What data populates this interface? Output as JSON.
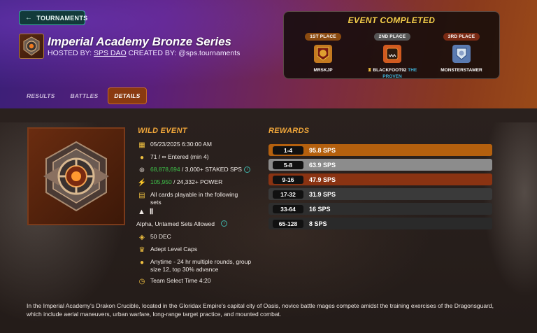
{
  "nav": {
    "back_label": "TOURNAMENTS"
  },
  "tournament": {
    "title": "Imperial Academy Bronze Series",
    "hosted_by_label": "HOSTED BY:",
    "host": "SPS DAO",
    "created_by_label": "CREATED BY:",
    "creator": "@sps.tournaments"
  },
  "tabs": [
    "RESULTS",
    "BATTLES",
    "DETAILS"
  ],
  "active_tab": "DETAILS",
  "event_panel": {
    "heading": "EVENT COMPLETED",
    "places": [
      {
        "label": "1ST PLACE",
        "name": "MRSKJP",
        "title": "",
        "color": "#8a4a10"
      },
      {
        "label": "2ND PLACE",
        "name": "BLACKFOOT92",
        "title": "THE PROVEN",
        "color": "#555555"
      },
      {
        "label": "3RD PLACE",
        "name": "MONSTERSTAMER",
        "title": "",
        "color": "#7a2a14"
      }
    ]
  },
  "details": {
    "section_title": "WILD EVENT",
    "start": "05/23/2025 6:30:00 AM",
    "entered": "71 / ∞ Entered (min 4)",
    "staked_value": "68,878,694",
    "staked_rest": " / 3,000+ STAKED SPS",
    "power_value": "105,950",
    "power_rest": " / 24,332+ POWER",
    "cards_text": "All cards playable in the following sets",
    "sets_text": "Alpha, Untamed Sets Allowed",
    "entry_fee": "50 DEC",
    "level_caps": "Adept Level Caps",
    "schedule": "Anytime - 24 hr multiple rounds, group size 12, top 30% advance",
    "team_select": "Team Select Time 4:20"
  },
  "rewards": {
    "section_title": "REWARDS",
    "rows": [
      {
        "range": "1-4",
        "amount": "95.8 SPS",
        "color": "#b4600e"
      },
      {
        "range": "5-8",
        "amount": "63.9 SPS",
        "color": "#8c8c8c"
      },
      {
        "range": "9-16",
        "amount": "47.9 SPS",
        "color": "#8a3312"
      },
      {
        "range": "17-32",
        "amount": "31.9 SPS",
        "color": "#3a3a3a"
      },
      {
        "range": "33-64",
        "amount": "16 SPS",
        "color": "#2e2e2e"
      },
      {
        "range": "65-128",
        "amount": "8 SPS",
        "color": "#2a2a2a"
      }
    ]
  },
  "description": "In the Imperial Academy's Drakon Crucible, located in the Gloridax Empire's capital city of Oasis, novice battle mages compete amidst the training exercises of the Dragonsguard, which include aerial maneuvers, urban warfare, long-range target practice, and mounted combat."
}
